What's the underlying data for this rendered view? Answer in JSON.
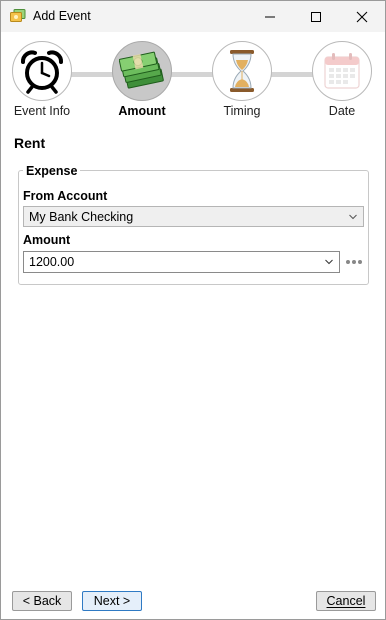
{
  "window": {
    "title": "Add Event",
    "colors": {
      "titlebar": "#f3f3f3",
      "accent": "#2f7ac4"
    }
  },
  "steps": [
    {
      "label": "Event Info",
      "icon": "alarm-clock-icon",
      "active": false
    },
    {
      "label": "Amount",
      "icon": "money-stack-icon",
      "active": true
    },
    {
      "label": "Timing",
      "icon": "hourglass-icon",
      "active": false
    },
    {
      "label": "Date",
      "icon": "calendar-icon",
      "active": false
    }
  ],
  "event": {
    "name": "Rent"
  },
  "expense": {
    "group_title": "Expense",
    "from_account_label": "From Account",
    "from_account_value": "My Bank Checking",
    "amount_label": "Amount",
    "amount_value": "1200.00"
  },
  "buttons": {
    "back": "< Back",
    "next": "Next >",
    "cancel": "Cancel"
  }
}
